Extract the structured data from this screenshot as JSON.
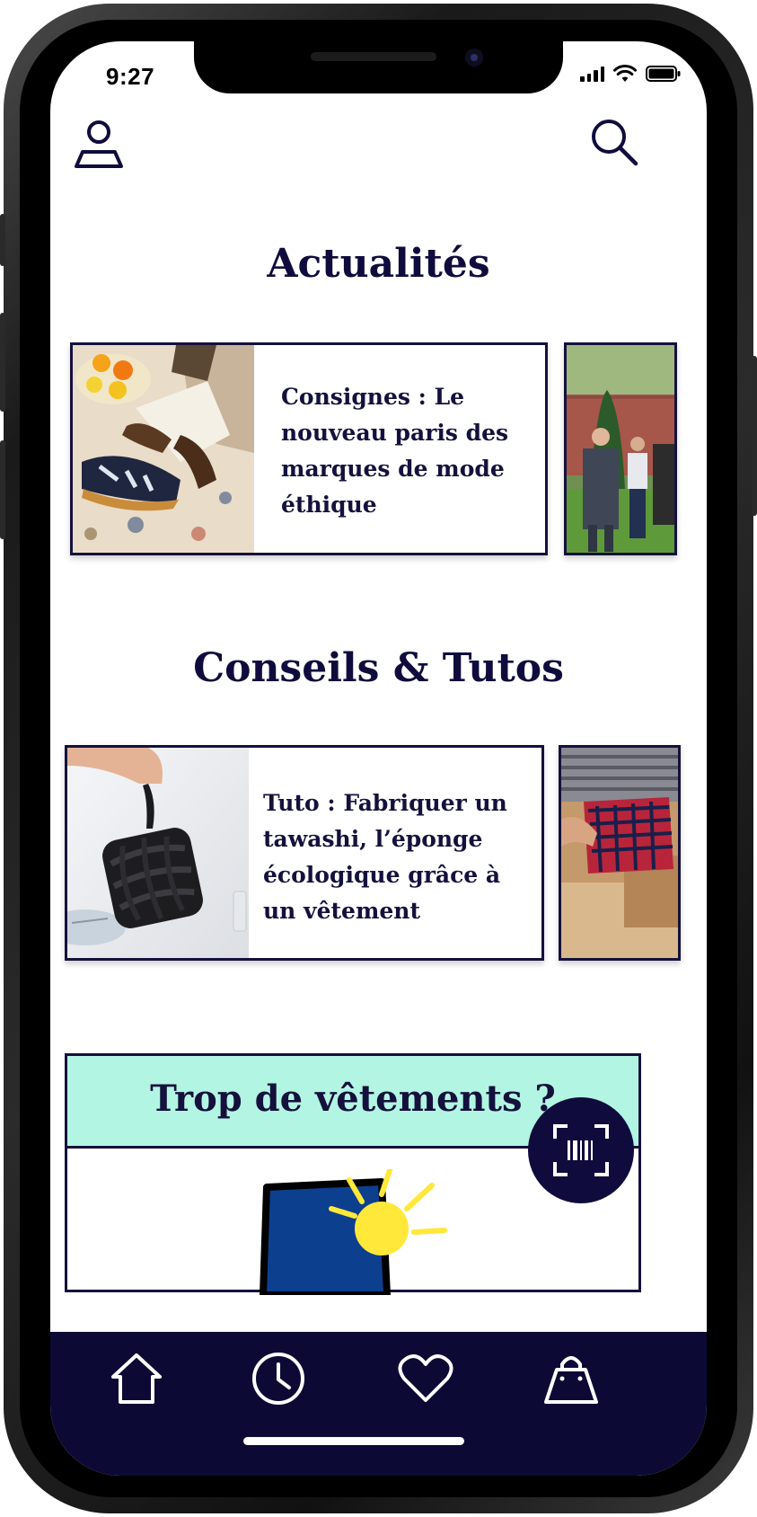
{
  "status": {
    "time": "9:27"
  },
  "header": {
    "profile_icon": "user-icon",
    "search_icon": "search-icon"
  },
  "news": {
    "title": "Actualités",
    "cards": [
      {
        "text": "Consignes : Le nouveau paris des marques de mode éthique"
      }
    ]
  },
  "tips": {
    "title": "Conseils & Tutos",
    "cards": [
      {
        "text": "Tuto : Fabriquer un tawashi, l’éponge écologique grâce à un vêtement"
      }
    ]
  },
  "promo": {
    "title": "Trop de vêtements ?"
  },
  "scan_button": {
    "icon": "barcode-scan-icon"
  },
  "tabbar": {
    "items": [
      {
        "icon": "home-icon"
      },
      {
        "icon": "clock-icon"
      },
      {
        "icon": "heart-icon"
      },
      {
        "icon": "shopping-bag-icon"
      }
    ]
  },
  "colors": {
    "navy": "#0f0c3d",
    "mint": "#b3f5e3",
    "tabbar": "#0c0a35"
  }
}
